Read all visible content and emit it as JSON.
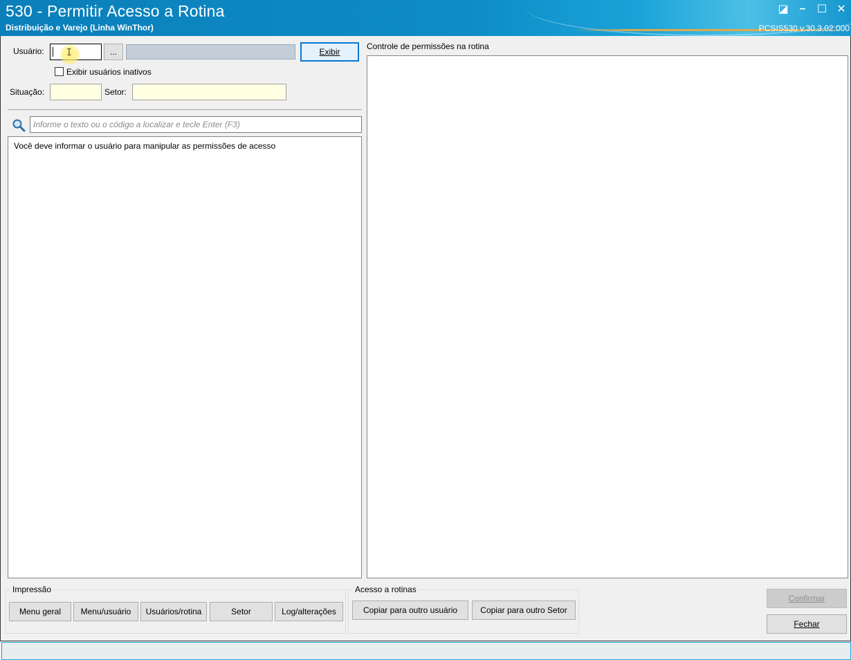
{
  "window": {
    "title": "530 - Permitir Acesso a Rotina",
    "subtitle": "Distribuição e Varejo (Linha WinThor)",
    "version": "PCSIS530  v.30.3.02.000",
    "controls": {
      "restore": "◪",
      "minimize": "–",
      "maximize": "☐",
      "close": "✕"
    }
  },
  "form": {
    "usuario_label": "Usuário:",
    "usuario_value": "",
    "lookup_button": "...",
    "usuario_name": "",
    "exibir_button": "Exibir",
    "inativos_label": "Exibir usuários inativos",
    "inativos_checked": false,
    "situacao_label": "Situação:",
    "situacao_value": "",
    "setor_label": "Setor:",
    "setor_value": ""
  },
  "search": {
    "icon": "search-icon",
    "placeholder": "Informe o texto ou o código a localizar e tecle Enter (F3)"
  },
  "left_panel": {
    "message": "Você deve informar o usuário para manipular as permissões de acesso"
  },
  "right_panel": {
    "title": "Controle de permissões na rotina"
  },
  "impressao": {
    "title": "Impressão",
    "buttons": [
      "Menu geral",
      "Menu/usuário",
      "Usuários/rotina",
      "Setor",
      "Log/alterações"
    ]
  },
  "acesso": {
    "title": "Acesso a rotinas",
    "buttons": [
      "Copiar para outro usuário",
      "Copiar para outro Setor"
    ]
  },
  "actions": {
    "confirmar": "Confirmar",
    "confirmar_enabled": false,
    "fechar": "Fechar"
  },
  "colors": {
    "title_blue": "#0d8cc6",
    "input_yellow": "#ffffe1",
    "focus_blue": "#0078d7"
  }
}
